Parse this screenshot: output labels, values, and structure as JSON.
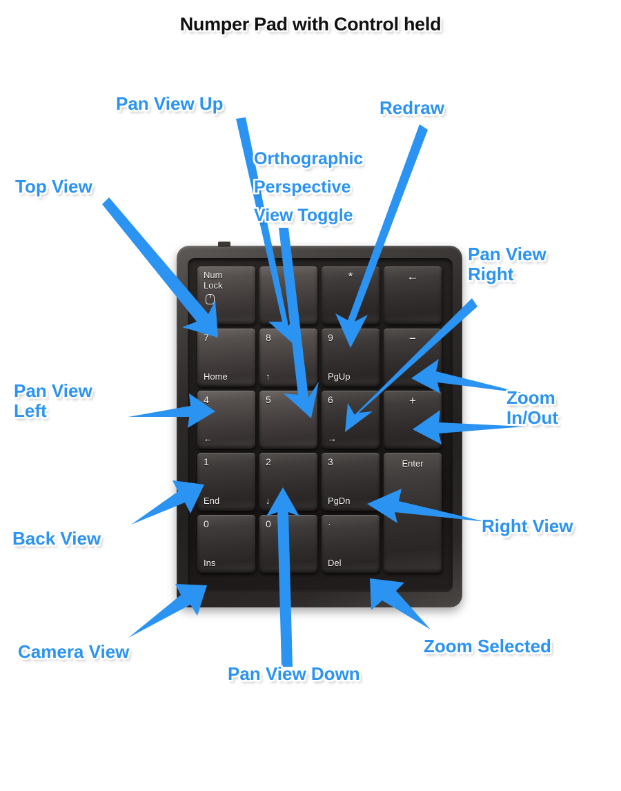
{
  "page": {
    "title": "Numper Pad with Control held",
    "accent_blue": "#2b93f2",
    "label_outline": "#ffffff",
    "background": "#ffffff"
  },
  "keypad": {
    "description": "numeric-keypad-photo",
    "rows": [
      [
        {
          "id": "numlock",
          "top": "Num",
          "top2": "Lock",
          "icon": "mouse-icon",
          "light": true
        },
        {
          "id": "divide",
          "center": "/",
          "light": true
        },
        {
          "id": "multiply",
          "center": "*",
          "light": false
        },
        {
          "id": "backspace",
          "center": "←",
          "light": false
        }
      ],
      [
        {
          "id": "key7",
          "num": "7",
          "sub": "Home",
          "light": true
        },
        {
          "id": "key8",
          "num": "8",
          "sub": "↑",
          "light": true
        },
        {
          "id": "key9",
          "num": "9",
          "sub": "PgUp",
          "light": false
        },
        {
          "id": "minus",
          "center": "−",
          "light": false
        }
      ],
      [
        {
          "id": "key4",
          "num": "4",
          "sub": "←",
          "light": true
        },
        {
          "id": "key5",
          "num": "5",
          "sub": "",
          "light": true
        },
        {
          "id": "key6",
          "num": "6",
          "sub": "→",
          "light": false
        },
        {
          "id": "plus",
          "center": "+",
          "light": false
        }
      ],
      [
        {
          "id": "key1",
          "num": "1",
          "sub": "End",
          "light": false
        },
        {
          "id": "key2",
          "num": "2",
          "sub": "↓",
          "light": false
        },
        {
          "id": "key3",
          "num": "3",
          "sub": "PgDn",
          "light": false
        },
        {
          "id": "enter",
          "center": "Enter",
          "light": false
        }
      ],
      [
        {
          "id": "key0",
          "num": "0",
          "sub": "Ins",
          "light": false
        },
        {
          "id": "key0b",
          "num": "0",
          "sub": "",
          "light": false
        },
        {
          "id": "decimal",
          "num": "·",
          "sub": "Del",
          "light": false
        }
      ]
    ]
  },
  "annotations": [
    {
      "id": "pan-view-up",
      "text": "Pan View Up",
      "target_key": "key8"
    },
    {
      "id": "top-view",
      "text": "Top View",
      "target_key": "key7"
    },
    {
      "id": "orthographic",
      "text": "Orthographic\nPerspective\nView Toggle",
      "target_key": "key5"
    },
    {
      "id": "redraw",
      "text": "Redraw",
      "target_key": "key9"
    },
    {
      "id": "pan-view-right",
      "text": "Pan View\nRight",
      "target_key": "key6"
    },
    {
      "id": "pan-view-left",
      "text": "Pan View\nLeft",
      "target_key": "key4"
    },
    {
      "id": "zoom-in-out",
      "text": "Zoom\nIn/Out",
      "target_key": "plus-minus"
    },
    {
      "id": "back-view",
      "text": "Back View",
      "target_key": "key1"
    },
    {
      "id": "right-view",
      "text": "Right View",
      "target_key": "key3"
    },
    {
      "id": "camera-view",
      "text": "Camera View",
      "target_key": "key0"
    },
    {
      "id": "zoom-selected",
      "text": "Zoom Selected",
      "target_key": "decimal"
    },
    {
      "id": "pan-view-down",
      "text": "Pan View Down",
      "target_key": "key2"
    }
  ]
}
